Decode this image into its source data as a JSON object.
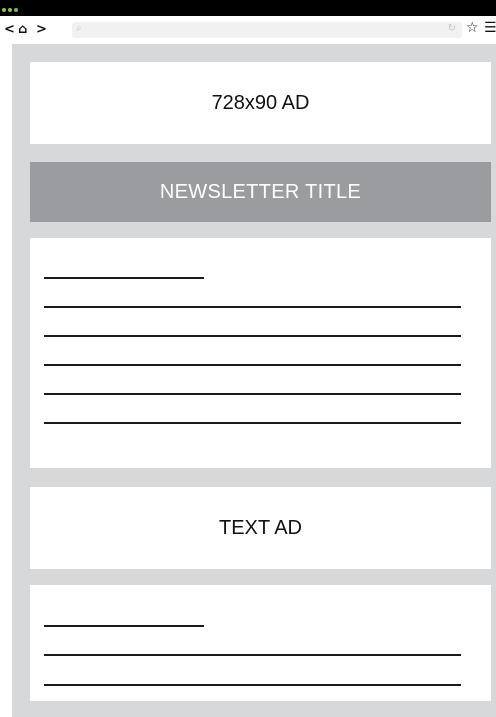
{
  "browser": {
    "nav": {
      "back": "<",
      "home": "⌂",
      "forward": ">"
    },
    "url": {
      "search_icon": "⌕",
      "reload_icon": "↻",
      "value": ""
    },
    "actions": {
      "bookmark_icon": "☆",
      "menu_icon": "☰"
    }
  },
  "page": {
    "top_ad": {
      "label": "728x90 AD"
    },
    "newsletter": {
      "title": "NEWSLETTER TITLE"
    },
    "text_ad": {
      "label": "TEXT AD"
    }
  },
  "colors": {
    "page_background": "#d6d8da",
    "title_band": "#9a9c9f",
    "card": "#ffffff",
    "text": "#111111"
  }
}
